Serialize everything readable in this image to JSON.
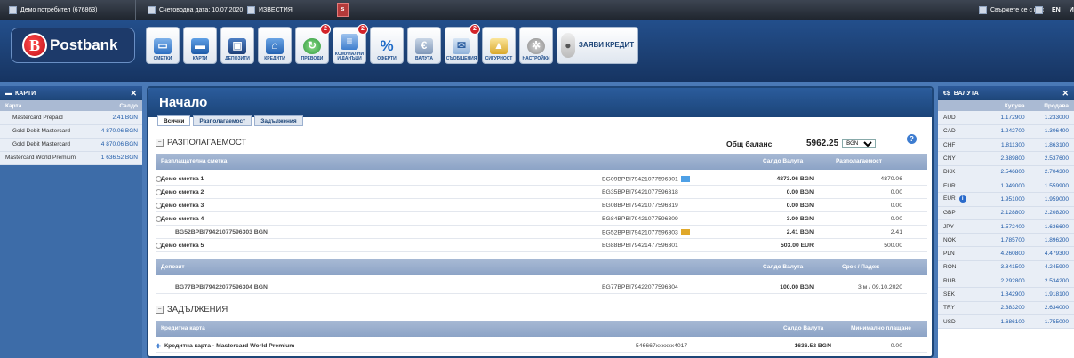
{
  "topbar": {
    "user": "Демо потребител (676863)",
    "date_label": "Счетоводна дата: 10.07.2020",
    "news": "ИЗВЕСТИЯ",
    "alert": "s",
    "contact": "Свържете се с нас",
    "lang": "EN",
    "lang2": "И"
  },
  "brand": {
    "logo_letter": "B",
    "name": "Postbank",
    "color": "#d3232a"
  },
  "nav": [
    {
      "label": "СМЕТКИ",
      "icon": "wallet-icon",
      "badge": ""
    },
    {
      "label": "КАРТИ",
      "icon": "card-icon",
      "badge": ""
    },
    {
      "label": "ДЕПОЗИТИ",
      "icon": "safe-icon",
      "badge": ""
    },
    {
      "label": "КРЕДИТИ",
      "icon": "house-icon",
      "badge": ""
    },
    {
      "label": "ПРЕВОДИ",
      "icon": "transfer-icon",
      "badge": "2"
    },
    {
      "label": "КОМУНАЛНИ И ДАНЪЦИ",
      "icon": "bills-icon",
      "badge": "2"
    },
    {
      "label": "ОФЕРТИ",
      "icon": "percent-icon",
      "badge": ""
    },
    {
      "label": "ВАЛУТА",
      "icon": "currency-icon",
      "badge": ""
    },
    {
      "label": "СЪОБЩЕНИЯ",
      "icon": "envelope-icon",
      "badge": "2"
    },
    {
      "label": "СИГУРНОСТ",
      "icon": "lock-icon",
      "badge": ""
    },
    {
      "label": "НАСТРОЙКИ",
      "icon": "gear-icon",
      "badge": ""
    }
  ],
  "apply_credit": "ЗАЯВИ КРЕДИТ",
  "cards_panel": {
    "title": "КАРТИ",
    "col_card": "Карта",
    "col_balance": "Салдо",
    "rows": [
      {
        "name": "Mastercard Prepaid",
        "balance": "2.41 BGN"
      },
      {
        "name": "Gold Debit Mastercard",
        "balance": "4 870.06 BGN"
      },
      {
        "name": "Gold Debit Mastercard",
        "balance": "4 870.06 BGN"
      },
      {
        "name": "Mastercard World Premium",
        "balance": "1 636.52 BGN"
      }
    ]
  },
  "main": {
    "title": "Начало",
    "tabs": [
      "Всички",
      "Разполагаемост",
      "Задължения"
    ],
    "availability": {
      "heading": "РАЗПОЛАГАЕМОСТ",
      "total_label": "Общ баланс",
      "total_value": "5962.25",
      "currency": "BGN",
      "col_account": "Разплащателна сметка",
      "col_balance": "Салдо Валута",
      "col_available": "Разполагаемост",
      "rows": [
        {
          "name": "Демо сметка 1",
          "iban": "BG09BPBI79421077596301",
          "balance": "4873.06 BGN",
          "available": "4870.06"
        },
        {
          "name": "Демо сметка 2",
          "iban": "BG35BPBI79421077596318",
          "balance": "0.00 BGN",
          "available": "0.00"
        },
        {
          "name": "Демо сметка 3",
          "iban": "BG08BPBI79421077596319",
          "balance": "0.00 BGN",
          "available": "0.00"
        },
        {
          "name": "Демо сметка 4",
          "iban": "BG84BPBI79421077596309",
          "balance": "3.00 BGN",
          "available": "0.00"
        },
        {
          "name": "BG52BPBI79421077596303 BGN",
          "iban": "BG52BPBI79421077596303",
          "balance": "2.41 BGN",
          "available": "2.41"
        },
        {
          "name": "Демо сметка 5",
          "iban": "BG88BPBI79421477596301",
          "balance": "503.00 EUR",
          "available": "500.00"
        }
      ],
      "deposit_col": "Депозит",
      "deposit_balance_col": "Салдо Валута",
      "deposit_term_col": "Срок / Падеж",
      "deposit": {
        "name": "BG77BPBI79422077596304 BGN",
        "iban": "BG77BPBI79422077596304",
        "balance": "100.00 BGN",
        "term": "3 м / 09.10.2020"
      }
    },
    "liabilities": {
      "heading": "ЗАДЪЛЖЕНИЯ",
      "col_card": "Кредитна карта",
      "col_balance": "Салдо Валута",
      "col_min": "Минимално плащане",
      "row": {
        "name": "Кредитна карта - Mastercard World Premium",
        "number": "546667xxxxxx4017",
        "balance": "1636.52 BGN",
        "min": "0.00"
      }
    }
  },
  "fx_panel": {
    "title": "ВАЛУТА",
    "col_buy": "Купува",
    "col_sell": "Продава",
    "rows": [
      {
        "ccy": "AUD",
        "buy": "1.172900",
        "sell": "1.233000"
      },
      {
        "ccy": "CAD",
        "buy": "1.242700",
        "sell": "1.306400"
      },
      {
        "ccy": "CHF",
        "buy": "1.811300",
        "sell": "1.863100"
      },
      {
        "ccy": "CNY",
        "buy": "2.389800",
        "sell": "2.537600"
      },
      {
        "ccy": "DKK",
        "buy": "2.546800",
        "sell": "2.704300"
      },
      {
        "ccy": "EUR",
        "buy": "1.949000",
        "sell": "1.559900"
      },
      {
        "ccy": "EUR",
        "buy": "1.951000",
        "sell": "1.959000"
      },
      {
        "ccy": "GBP",
        "buy": "2.128800",
        "sell": "2.208200"
      },
      {
        "ccy": "JPY",
        "buy": "1.572400",
        "sell": "1.636600"
      },
      {
        "ccy": "NOK",
        "buy": "1.785700",
        "sell": "1.896200"
      },
      {
        "ccy": "PLN",
        "buy": "4.260800",
        "sell": "4.479300"
      },
      {
        "ccy": "RON",
        "buy": "3.841500",
        "sell": "4.245900"
      },
      {
        "ccy": "RUB",
        "buy": "2.292800",
        "sell": "2.534200"
      },
      {
        "ccy": "SEK",
        "buy": "1.842900",
        "sell": "1.918100"
      },
      {
        "ccy": "TRY",
        "buy": "2.383200",
        "sell": "2.634000"
      },
      {
        "ccy": "USD",
        "buy": "1.686100",
        "sell": "1.755000"
      }
    ]
  }
}
